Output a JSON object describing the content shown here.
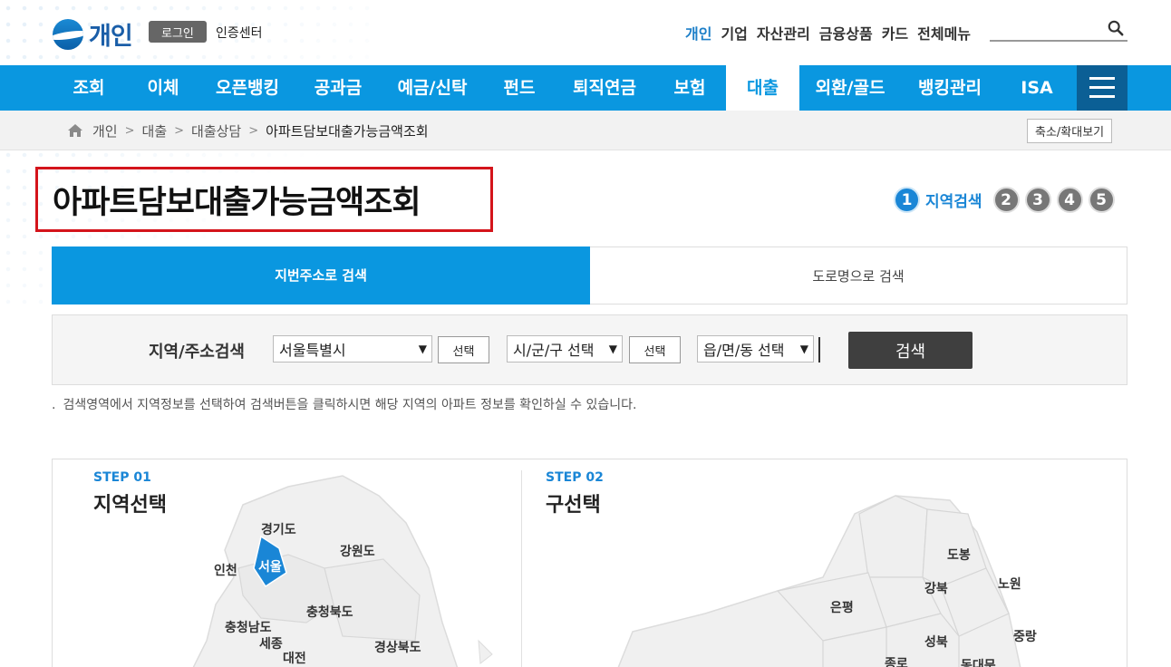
{
  "header": {
    "logo_text": "개인",
    "login_label": "로그인",
    "cert_label": "인증센터",
    "top_links": [
      {
        "label": "개인",
        "active": true
      },
      {
        "label": "기업",
        "active": false
      },
      {
        "label": "자산관리",
        "active": false
      },
      {
        "label": "금융상품",
        "active": false
      },
      {
        "label": "카드",
        "active": false
      },
      {
        "label": "전체메뉴",
        "active": false
      }
    ],
    "search_icon": "search-icon"
  },
  "nav": {
    "items": [
      {
        "label": "조회"
      },
      {
        "label": "이체"
      },
      {
        "label": "오픈뱅킹"
      },
      {
        "label": "공과금"
      },
      {
        "label": "예금/신탁"
      },
      {
        "label": "펀드"
      },
      {
        "label": "퇴직연금"
      },
      {
        "label": "보험"
      },
      {
        "label": "대출",
        "active": true
      },
      {
        "label": "외환/골드"
      },
      {
        "label": "뱅킹관리"
      },
      {
        "label": "ISA"
      }
    ],
    "menu_icon": "hamburger-icon",
    "accent": "#0a97e0"
  },
  "breadcrumb": {
    "items": [
      "개인",
      "대출",
      "대출상담",
      "아파트담보대출가능금액조회"
    ],
    "zoom_label": "축소/확대보기"
  },
  "page": {
    "title": "아파트담보대출가능금액조회",
    "steps": {
      "current": "1",
      "current_label": "지역검색",
      "others": [
        "2",
        "3",
        "4",
        "5"
      ]
    }
  },
  "search": {
    "tabs": [
      "지번주소로 검색",
      "도로명으로 검색"
    ],
    "label": "지역/주소검색",
    "city_select": "서울특별시",
    "pick_label": "선택",
    "district_select": "시/군/구 선택",
    "pick_label2": "선택",
    "dong_select": "읍/면/동 선택",
    "search_button": "검색",
    "note": "검색영역에서 지역정보를 선택하여 검색버튼을 클릭하시면 해당 지역의 아파트 정보를 확인하실 수 있습니다."
  },
  "maps": {
    "left": {
      "step": "STEP 01",
      "title": "지역선택",
      "regions": [
        "경기도",
        "강원도",
        "인천",
        "서울",
        "충청북도",
        "충청남도",
        "세종",
        "대전",
        "경상북도"
      ],
      "selected": "서울"
    },
    "right": {
      "step": "STEP 02",
      "title": "구선택",
      "regions": [
        "도봉",
        "노원",
        "강북",
        "은평",
        "성북",
        "중랑",
        "종로",
        "동대문"
      ]
    }
  }
}
